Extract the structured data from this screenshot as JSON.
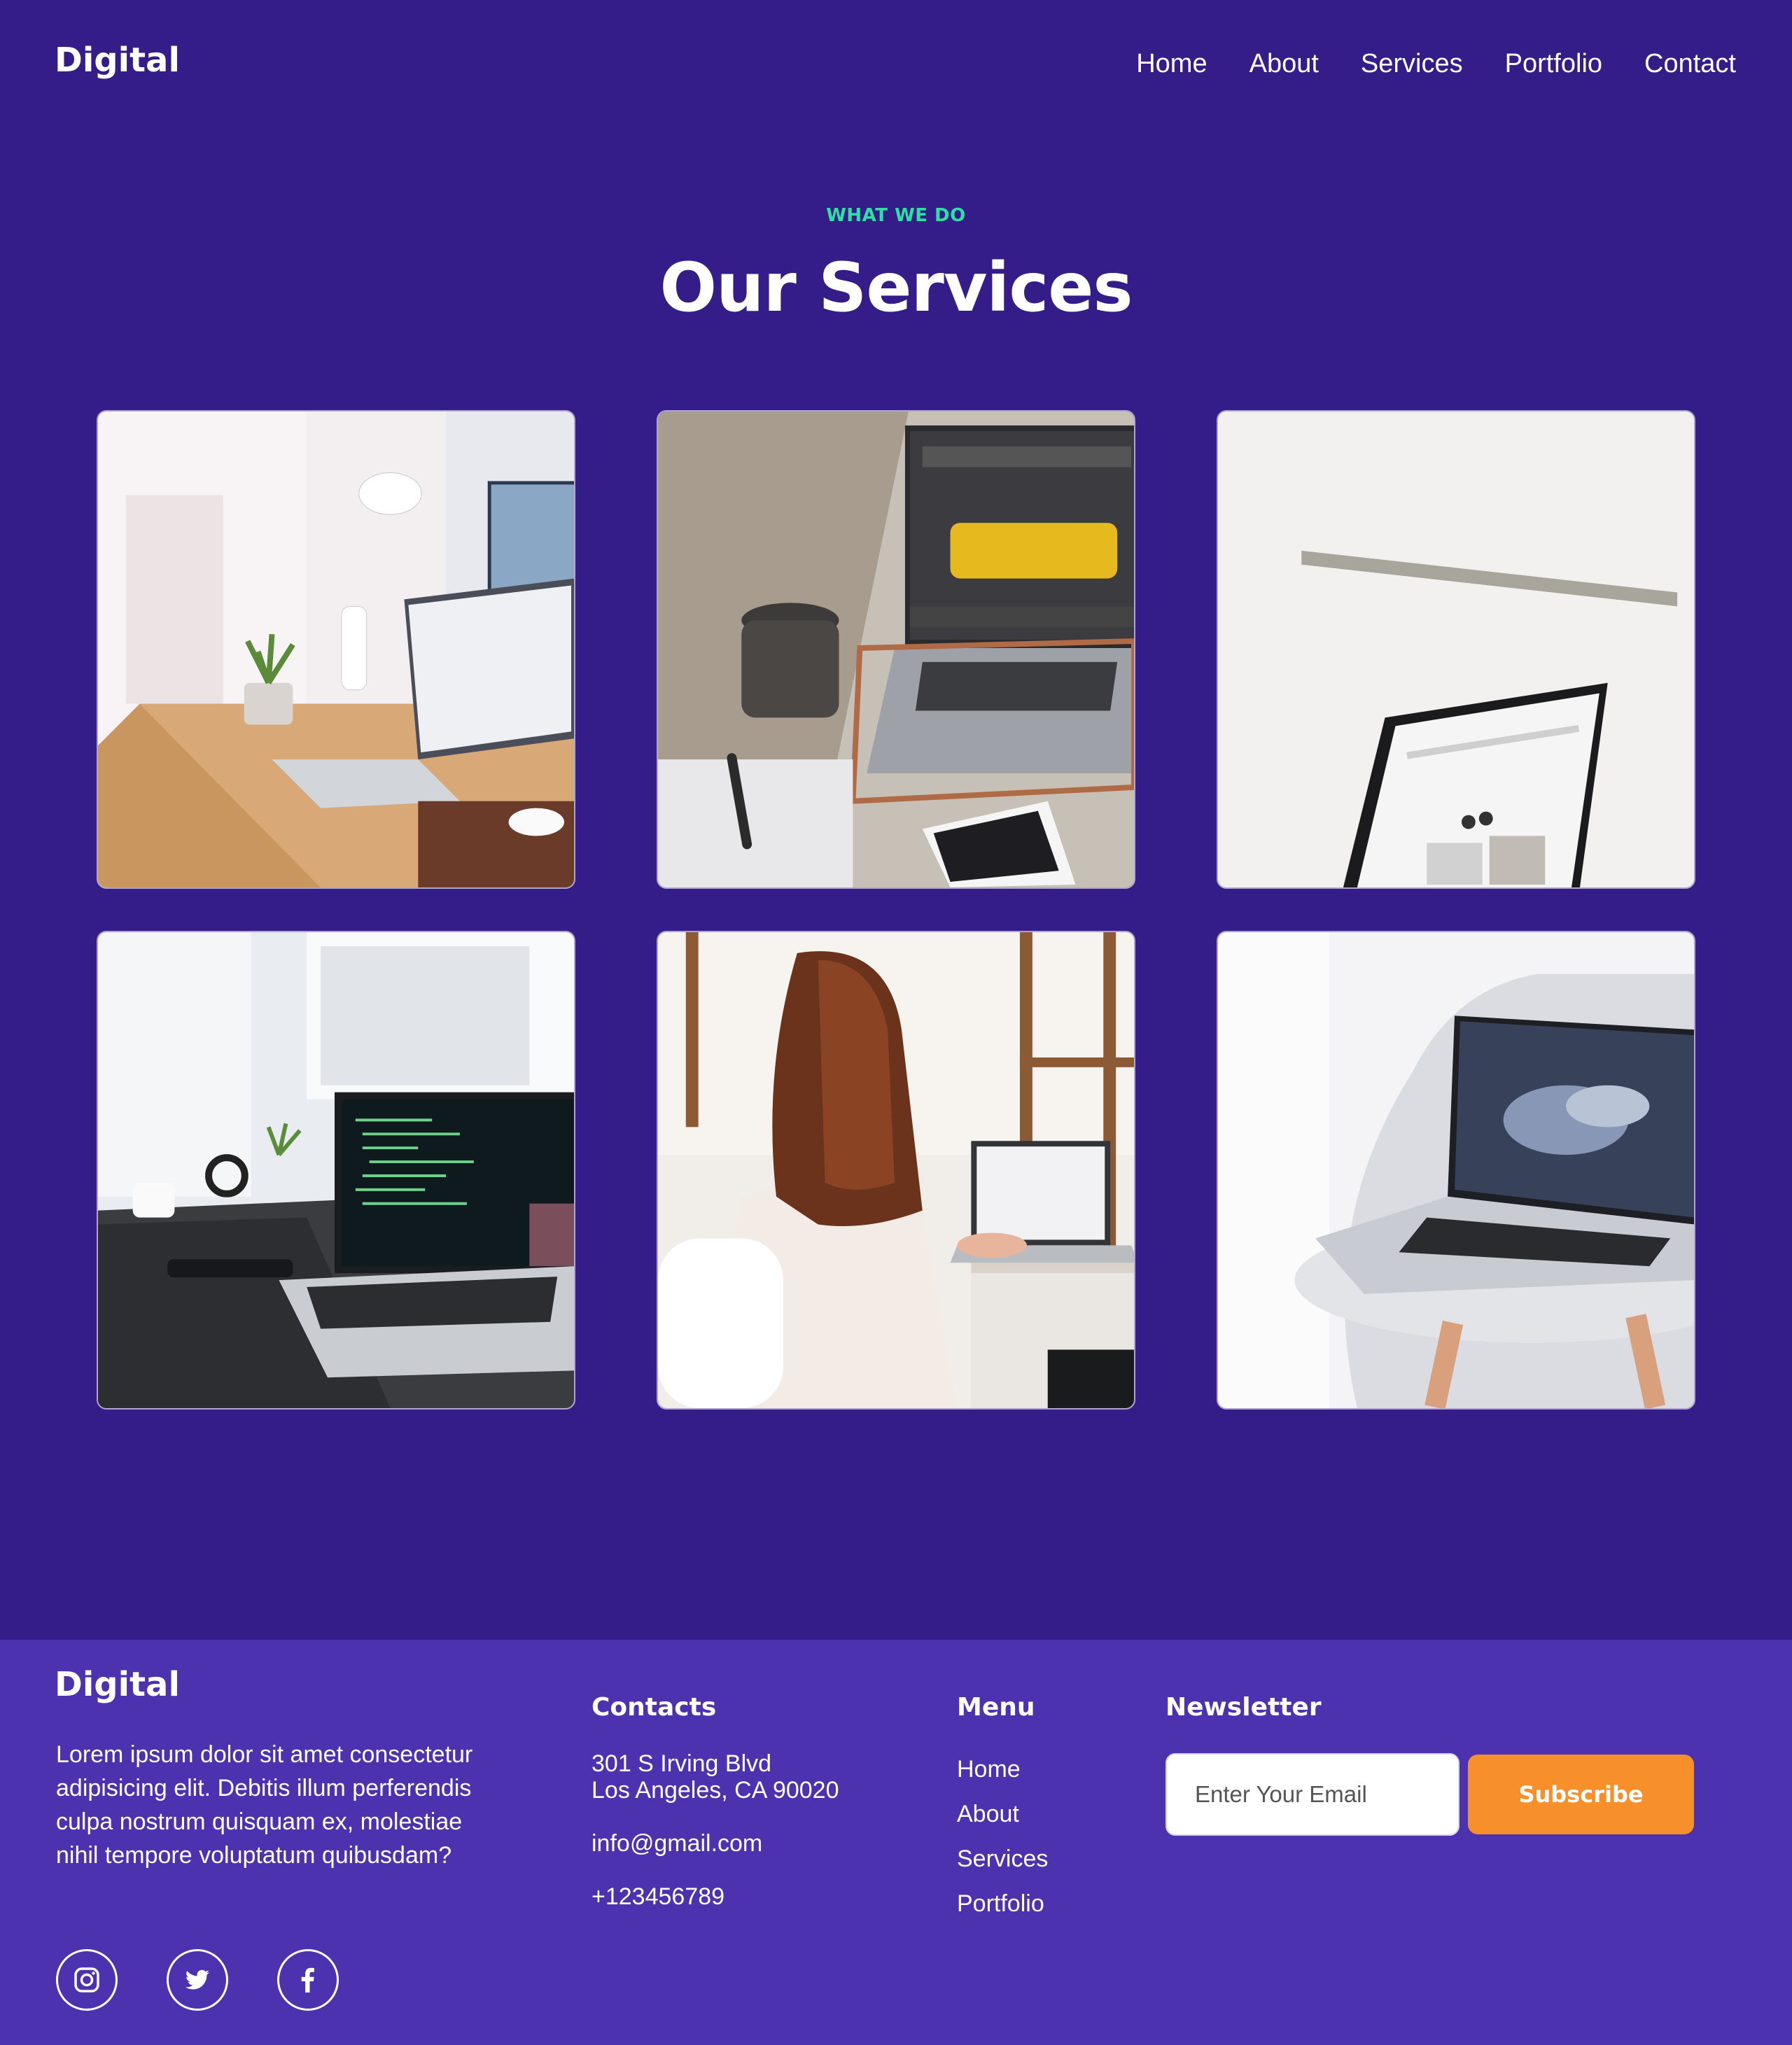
{
  "header": {
    "logo": "Digital",
    "nav": [
      "Home",
      "About",
      "Services",
      "Portfolio",
      "Contact"
    ]
  },
  "services": {
    "eyebrow": "WHAT WE DO",
    "title": "Our Services",
    "tiles": [
      {
        "icon": "desk-with-laptops-photo"
      },
      {
        "icon": "laptop-coffee-phone-photo"
      },
      {
        "icon": "laptop-white-wall-photo"
      },
      {
        "icon": "coding-laptop-photo"
      },
      {
        "icon": "woman-working-photo"
      },
      {
        "icon": "laptop-on-chair-photo"
      }
    ]
  },
  "footer": {
    "logo": "Digital",
    "description": "Lorem ipsum dolor sit amet consectetur adipisicing elit. Debitis illum perferendis culpa nostrum quisquam ex, molestiae nihil tempore voluptatum quibusdam?",
    "contacts": {
      "title": "Contacts",
      "address_line1": "301 S Irving Blvd",
      "address_line2": "Los Angeles, CA 90020",
      "email": "info@gmail.com",
      "phone": "+123456789"
    },
    "menu": {
      "title": "Menu",
      "items": [
        "Home",
        "About",
        "Services",
        "Portfolio"
      ]
    },
    "newsletter": {
      "title": "Newsletter",
      "placeholder": "Enter Your Email",
      "button": "Subscribe"
    },
    "socials": [
      "instagram-icon",
      "twitter-icon",
      "facebook-icon"
    ]
  },
  "colors": {
    "background": "#351d89",
    "footer": "#4c32ae",
    "accent": "#2fe0a3",
    "button": "#f78f2b"
  }
}
